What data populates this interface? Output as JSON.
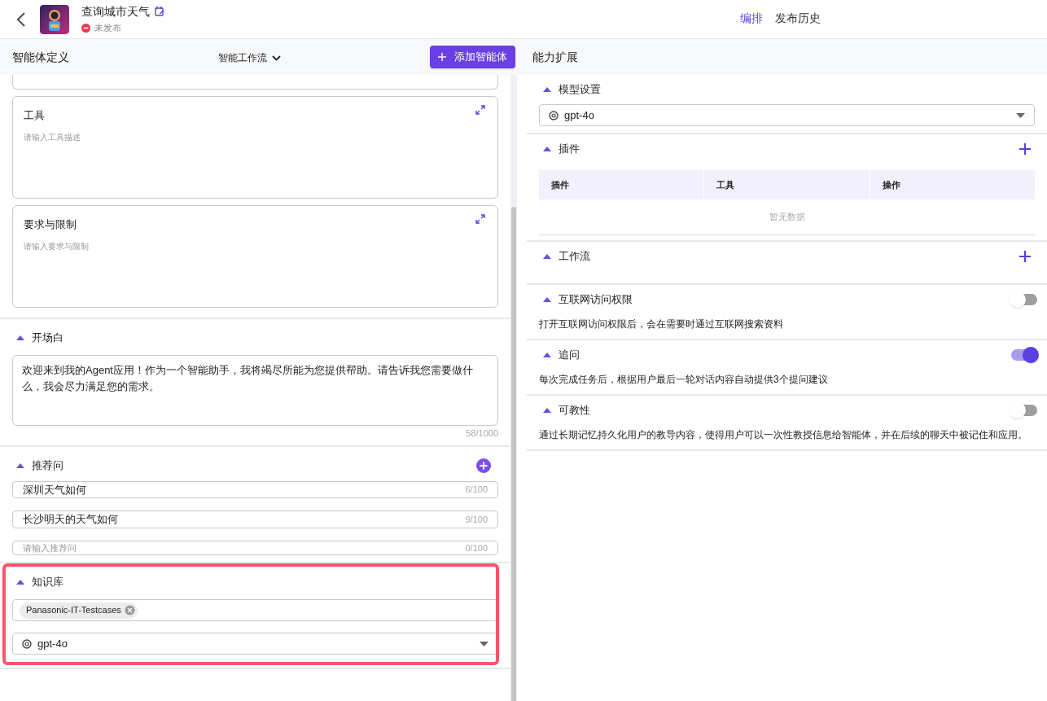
{
  "header": {
    "title": "查询城市天气",
    "status": "未发布",
    "tabs": [
      {
        "label": "编排",
        "selected": true
      },
      {
        "label": "发布历史",
        "selected": false
      }
    ]
  },
  "left": {
    "title": "智能体定义",
    "mode": "智能工作流",
    "add_button": "添加智能体",
    "prompt_cards": [
      {
        "title": "工具",
        "placeholder": "请输入工具描述"
      },
      {
        "title": "要求与限制",
        "placeholder": "请输入要求与限制"
      }
    ],
    "opening": {
      "title": "开场白",
      "value": "欢迎来到我的Agent应用！作为一个智能助手，我将竭尽所能为您提供帮助。请告诉我您需要做什么，我会尽力满足您的需求。",
      "count": "58/1000"
    },
    "suggestions": {
      "title": "推荐问",
      "items": [
        {
          "value": "深圳天气如何",
          "count": "6/100"
        },
        {
          "value": "长沙明天的天气如何",
          "count": "9/100"
        },
        {
          "placeholder": "请输入推荐问",
          "count": "0/100"
        }
      ]
    },
    "knowledge": {
      "title": "知识库",
      "highlighted": true,
      "tags": [
        "Panasonic-IT-Testcases"
      ],
      "model": "gpt-4o"
    }
  },
  "right": {
    "title": "能力扩展",
    "model": {
      "title": "模型设置",
      "value": "gpt-4o"
    },
    "plugins": {
      "title": "插件",
      "columns": [
        "插件",
        "工具",
        "操作"
      ],
      "empty": "暂无数据"
    },
    "workflow": {
      "title": "工作流"
    },
    "toggles": [
      {
        "title": "互联网访问权限",
        "on": false,
        "description": "打开互联网访问权限后，会在需要时通过互联网搜索资料"
      },
      {
        "title": "追问",
        "on": true,
        "description": "每次完成任务后，根据用户最后一轮对话内容自动提供3个提问建议"
      },
      {
        "title": "可教性",
        "on": false,
        "description": "通过长期记忆持久化用户的教导内容，使得用户可以一次性教授信息给智能体，并在后续的聊天中被记住和应用。"
      }
    ]
  }
}
